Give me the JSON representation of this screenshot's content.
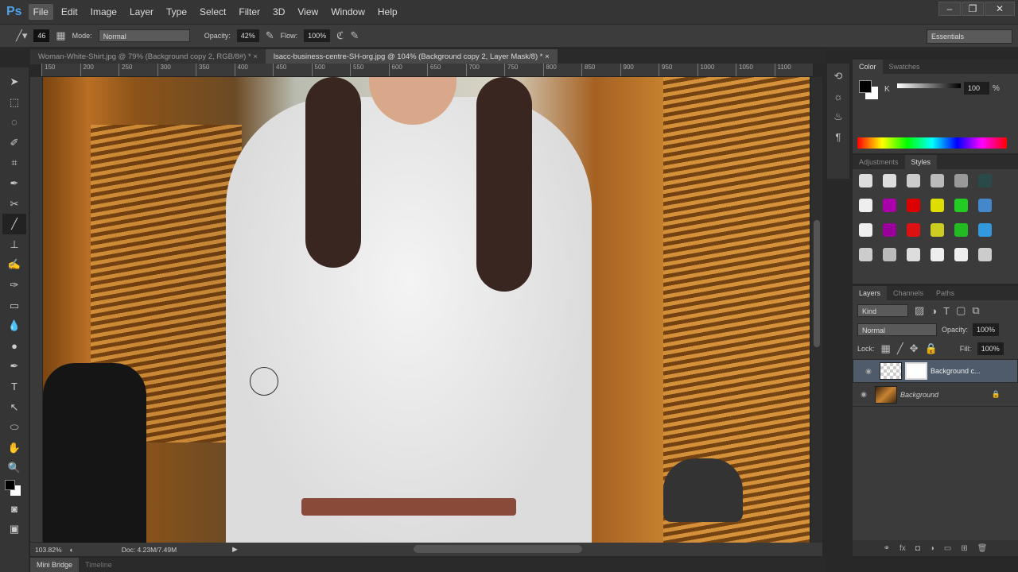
{
  "app": {
    "logo": "Ps",
    "menu": [
      "File",
      "Edit",
      "Image",
      "Layer",
      "Type",
      "Select",
      "Filter",
      "3D",
      "View",
      "Window",
      "Help"
    ],
    "window_buttons": [
      "–",
      "❐",
      "✕"
    ]
  },
  "options": {
    "brush_size": "46",
    "mode_label": "Mode:",
    "mode_value": "Normal",
    "opacity_label": "Opacity:",
    "opacity_value": "42%",
    "flow_label": "Flow:",
    "flow_value": "100%",
    "workspace": "Essentials"
  },
  "tabs": [
    {
      "label": "Woman-White-Shirt.jpg @ 79% (Background copy 2, RGB/8#) *",
      "close": "×"
    },
    {
      "label": "lsacc-business-centre-SH-org.jpg @ 104% (Background copy 2, Layer Mask/8) *",
      "close": "×"
    }
  ],
  "ruler": [
    "150",
    "200",
    "250",
    "300",
    "350",
    "400",
    "450",
    "500",
    "550",
    "600",
    "650",
    "700",
    "750",
    "800",
    "850",
    "900",
    "950",
    "1000",
    "1050",
    "1100"
  ],
  "status": {
    "zoom": "103.82%",
    "doc": "Doc: 4.23M/7.49M"
  },
  "bottom_tabs": [
    "Mini Bridge",
    "Timeline"
  ],
  "color_panel": {
    "tabs": [
      "Color",
      "Swatches"
    ],
    "k_label": "K",
    "k_value": "100",
    "percent": "%"
  },
  "styles_panel": {
    "tabs": [
      "Adjustments",
      "Styles"
    ],
    "swatch_colors": [
      "#ddd",
      "#ddd",
      "#ccc",
      "#bbb",
      "#999",
      "#2a4a4a",
      "#eee",
      "#a0a",
      "#d00",
      "#dd0",
      "#2c2",
      "#48c",
      "#eee",
      "#909",
      "#d11",
      "#cc2",
      "#2b2",
      "#39d",
      "#ccc",
      "#bbb",
      "#ddd",
      "#eee",
      "#eee",
      "#ccc"
    ]
  },
  "layers_panel": {
    "tabs": [
      "Layers",
      "Channels",
      "Paths"
    ],
    "kind": "Kind",
    "blend": "Normal",
    "opacity_label": "Opacity:",
    "opacity_value": "100%",
    "lock_label": "Lock:",
    "fill_label": "Fill:",
    "fill_value": "100%",
    "layers": [
      {
        "name": "Background c...",
        "selected": true
      },
      {
        "name": "Background",
        "selected": false,
        "locked": true
      }
    ]
  }
}
